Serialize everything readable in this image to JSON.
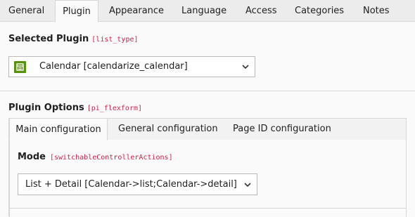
{
  "tabs": [
    {
      "label": "General"
    },
    {
      "label": "Plugin"
    },
    {
      "label": "Appearance"
    },
    {
      "label": "Language"
    },
    {
      "label": "Access"
    },
    {
      "label": "Categories"
    },
    {
      "label": "Notes"
    }
  ],
  "active_tab": "Plugin",
  "selected_plugin": {
    "label": "Selected Plugin",
    "field": "[list_type]",
    "value": "Calendar [calendarize_calendar]",
    "icon": "calendar-plugin-icon"
  },
  "plugin_options": {
    "label": "Plugin Options",
    "field": "[pi_flexform]",
    "tabs": [
      {
        "label": "Main configuration"
      },
      {
        "label": "General configuration"
      },
      {
        "label": "Page ID configuration"
      }
    ],
    "active_tab": "Main configuration",
    "mode": {
      "label": "Mode",
      "field": "[switchableControllerActions]",
      "value": "List + Detail [Calendar->list;Calendar->detail]"
    }
  },
  "colors": {
    "field_code": "#c7254e",
    "plugin_icon": "#59920e",
    "tab_bar": "#ececec",
    "border": "#d7d7d7"
  }
}
